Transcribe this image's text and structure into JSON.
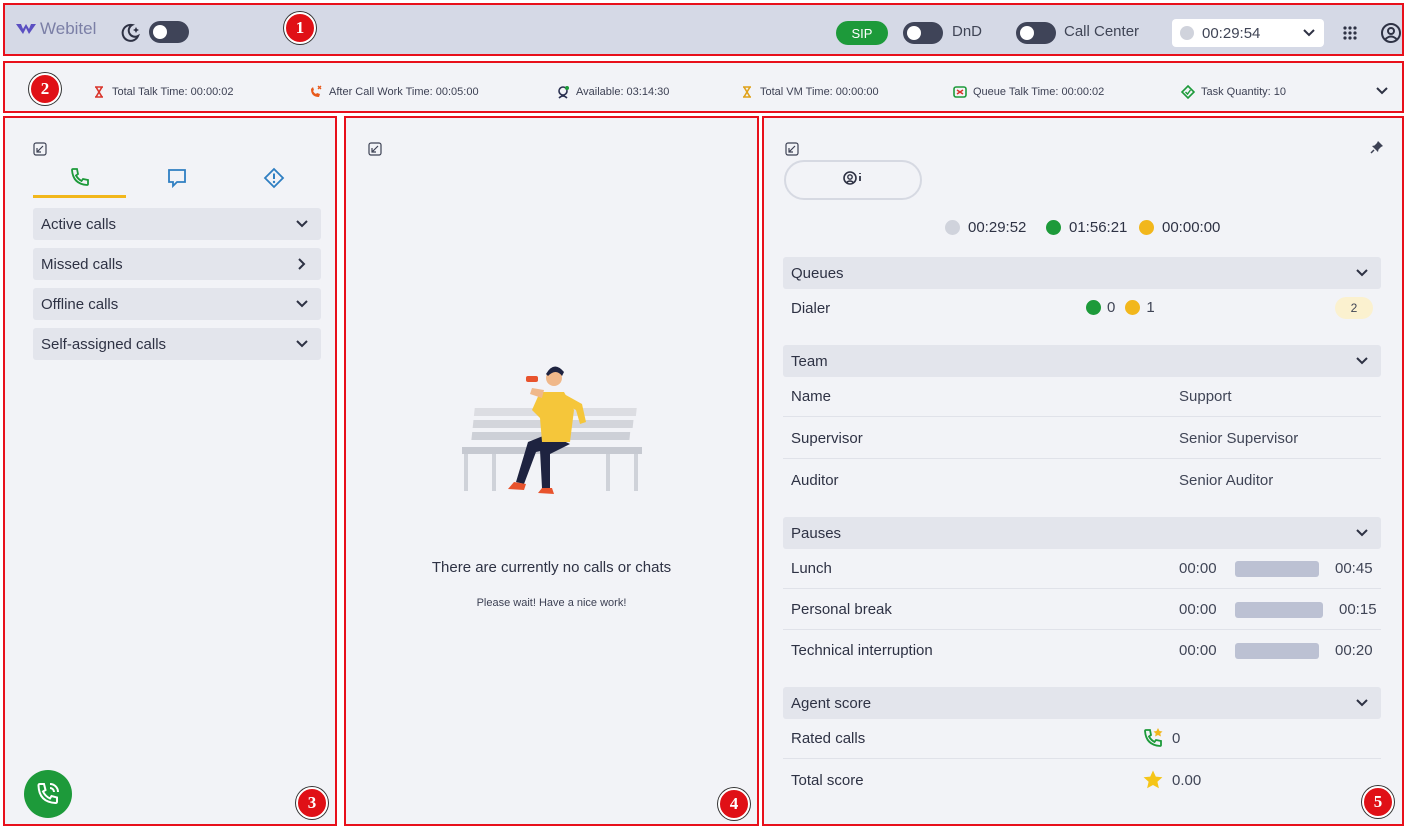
{
  "header": {
    "logo": "Webitel",
    "sip": "SIP",
    "dnd_label": "DnD",
    "call_center_label": "Call Center",
    "status_time": "00:29:54"
  },
  "stats": [
    {
      "label": "Total Talk Time: 00:00:02",
      "icon": "talk-time-icon",
      "color": "#d9342b"
    },
    {
      "label": "After Call Work Time: 00:05:00",
      "icon": "after-call-icon",
      "color": "#e85a1c"
    },
    {
      "label": "Available: 03:14:30",
      "icon": "available-icon",
      "color": "#2a3050"
    },
    {
      "label": "Total VM Time: 00:00:00",
      "icon": "vm-time-icon",
      "color": "#e0a21a"
    },
    {
      "label": "Queue Talk Time: 00:00:02",
      "icon": "queue-talk-icon",
      "color": "#1d9a3a"
    },
    {
      "label": "Task Quantity: 10",
      "icon": "task-icon",
      "color": "#1d9a3a"
    }
  ],
  "badges": [
    "1",
    "2",
    "3",
    "4",
    "5"
  ],
  "left": {
    "sections": [
      "Active calls",
      "Missed calls",
      "Offline calls",
      "Self-assigned calls"
    ]
  },
  "middle": {
    "title": "There are currently no calls or chats",
    "subtitle": "Please wait! Have a nice work!"
  },
  "right": {
    "timers": [
      "00:29:52",
      "01:56:21",
      "00:00:00"
    ],
    "queues": {
      "title": "Queues",
      "name": "Dialer",
      "green": "0",
      "yellow": "1",
      "count": "2"
    },
    "team": {
      "title": "Team",
      "rows": [
        {
          "label": "Name",
          "value": "Support"
        },
        {
          "label": "Supervisor",
          "value": "Senior Supervisor"
        },
        {
          "label": "Auditor",
          "value": "Senior Auditor"
        }
      ]
    },
    "pauses": {
      "title": "Pauses",
      "rows": [
        {
          "label": "Lunch",
          "start": "00:00",
          "end": "00:45"
        },
        {
          "label": "Personal break",
          "start": "00:00",
          "end": "00:15"
        },
        {
          "label": "Technical interruption",
          "start": "00:00",
          "end": "00:20"
        }
      ]
    },
    "score": {
      "title": "Agent score",
      "rated_label": "Rated calls",
      "rated_value": "0",
      "total_label": "Total score",
      "total_value": "0.00"
    }
  },
  "colors": {
    "green": "#1d9a3a",
    "yellow": "#f2b71c",
    "gray": "#d0d3dc"
  }
}
